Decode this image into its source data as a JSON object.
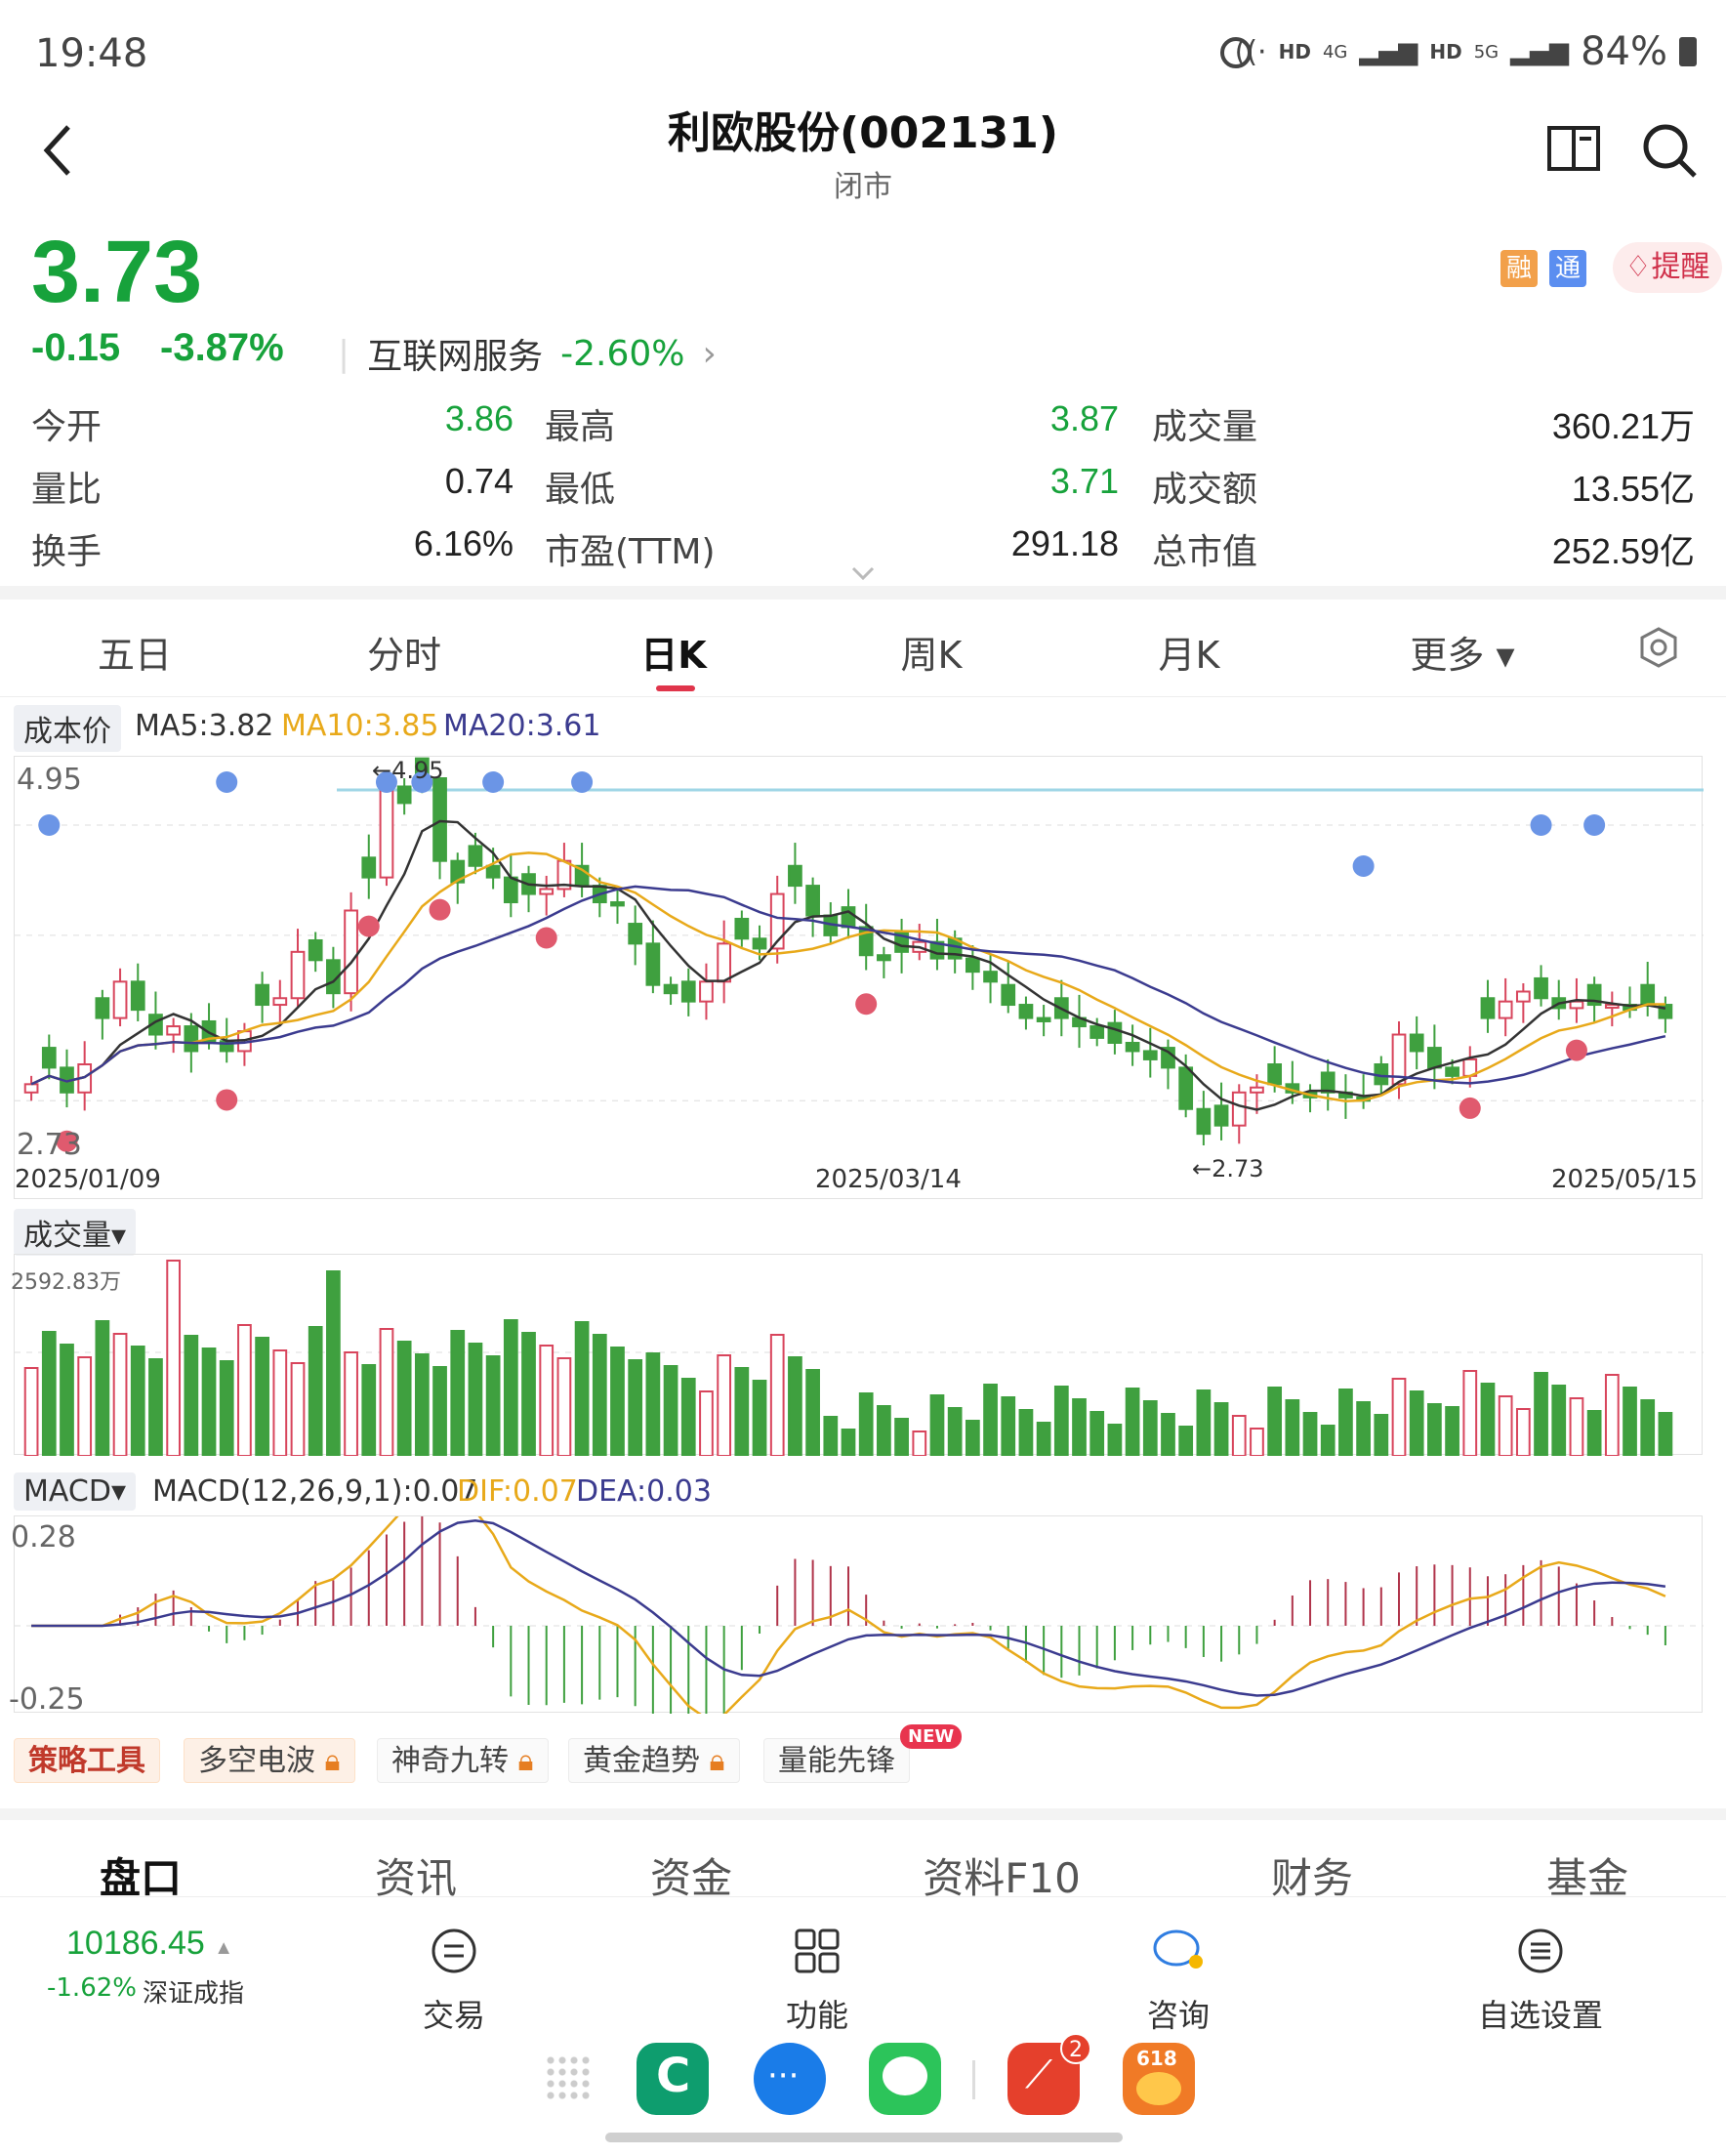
{
  "status_bar": {
    "time": "19:48",
    "net1": "HD",
    "net2": "4G",
    "net3": "HD",
    "net4": "5G",
    "battery": "84%"
  },
  "header": {
    "title": "利欧股份(002131)",
    "subtitle": "闭市"
  },
  "quote": {
    "price": "3.73",
    "change": "-0.15",
    "change_pct": "-3.87%",
    "industry": "互联网服务",
    "industry_pct": "-2.60%",
    "badges": [
      "融",
      "通"
    ],
    "remind": "提醒",
    "stats": [
      {
        "label": "今开",
        "value": "3.86"
      },
      {
        "label": "最高",
        "value": "3.87"
      },
      {
        "label": "成交量",
        "value": "360.21万"
      },
      {
        "label": "量比",
        "value": "0.74"
      },
      {
        "label": "最低",
        "value": "3.71"
      },
      {
        "label": "成交额",
        "value": "13.55亿"
      },
      {
        "label": "换手",
        "value": "6.16%"
      },
      {
        "label": "市盈(TTM)",
        "value": "291.18"
      },
      {
        "label": "总市值",
        "value": "252.59亿"
      }
    ]
  },
  "period_tabs": [
    "五日",
    "分时",
    "日K",
    "周K",
    "月K",
    "更多"
  ],
  "active_tab": "日K",
  "kline": {
    "cost_label": "成本价",
    "ma5": "MA5:3.82",
    "ma10": "MA10:3.85",
    "ma20": "MA20:3.61",
    "y_max_label": "4.95",
    "y_min_label": "2.73",
    "high_marker": "←4.95",
    "low_marker": "←2.73",
    "dates": [
      "2025/01/09",
      "2025/03/14",
      "2025/05/15"
    ],
    "colors": {
      "up": "#d8455c",
      "down": "#3fa03f",
      "ma5": "#333333",
      "ma10": "#e8a91a",
      "ma20": "#3b3b8f",
      "ref": "#9fd6e6"
    }
  },
  "volume": {
    "label": "成交量",
    "max_label": "2592.83万"
  },
  "macd": {
    "label": "MACD",
    "value": "MACD(12,26,9,1):0.07",
    "dif": "DIF:0.07",
    "dea": "DEA:0.03",
    "top": "0.28",
    "bottom": "-0.25"
  },
  "chart_data": {
    "type": "candlestick",
    "ylim": [
      2.73,
      4.95
    ],
    "closes": [
      3.1,
      3.2,
      3.05,
      3.22,
      3.5,
      3.72,
      3.55,
      3.4,
      3.45,
      3.3,
      3.36,
      3.3,
      3.42,
      3.58,
      3.62,
      3.9,
      3.85,
      3.65,
      4.15,
      4.35,
      4.9,
      4.8,
      4.95,
      4.45,
      4.32,
      4.42,
      4.35,
      4.2,
      4.25,
      4.28,
      4.45,
      4.3,
      4.2,
      4.18,
      3.95,
      3.7,
      3.65,
      3.6,
      3.72,
      3.95,
      3.98,
      3.92,
      4.25,
      4.3,
      4.12,
      4.0,
      4.05,
      3.88,
      3.85,
      3.9,
      3.96,
      3.86,
      3.86,
      3.78,
      3.72,
      3.58,
      3.5,
      3.48,
      3.5,
      3.45,
      3.38,
      3.35,
      3.3,
      3.25,
      3.2,
      2.95,
      2.8,
      2.85,
      3.05,
      3.08,
      3.1,
      3.05,
      3.02,
      3.05,
      3.02,
      3.0,
      3.1,
      3.4,
      3.3,
      3.2,
      3.15,
      3.25,
      3.5,
      3.6,
      3.66,
      3.62,
      3.56,
      3.6,
      3.58,
      3.58,
      3.55,
      3.58,
      3.5
    ],
    "macd_top": 0.28,
    "macd_bottom": -0.25
  },
  "strategy": {
    "label": "策略工具",
    "items": [
      "多空电波",
      "神奇九转",
      "黄金趋势",
      "量能先锋"
    ],
    "new_badge": "NEW"
  },
  "bottom_tabs": [
    "盘口",
    "资讯",
    "资金",
    "资料F10",
    "财务",
    "基金"
  ],
  "index": {
    "value": "10186.45",
    "pct": "-1.62%",
    "name": "深证成指"
  },
  "dock": [
    "交易",
    "功能",
    "咨询",
    "自选设置"
  ],
  "app_badge": "2",
  "app_618": "618"
}
